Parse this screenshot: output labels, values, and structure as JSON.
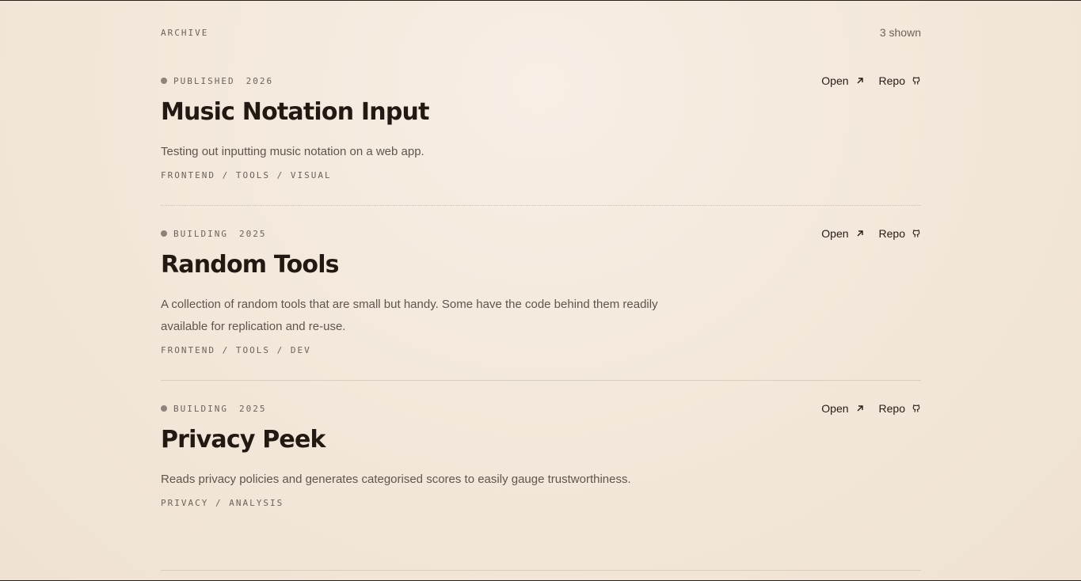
{
  "header": {
    "section_label": "ARCHIVE",
    "count": "3 shown"
  },
  "actions": {
    "open_label": "Open",
    "repo_label": "Repo"
  },
  "projects": [
    {
      "status": "PUBLISHED",
      "year": "2026",
      "title": "Music Notation Input",
      "description": "Testing out inputting music notation on a web app.",
      "tags": "FRONTEND / TOOLS / VISUAL"
    },
    {
      "status": "BUILDING",
      "year": "2025",
      "title": "Random Tools",
      "description": "A collection of random tools that are small but handy. Some have the code behind them readily available for replication and re-use.",
      "tags": "FRONTEND / TOOLS / DEV"
    },
    {
      "status": "BUILDING",
      "year": "2025",
      "title": "Privacy Peek",
      "description": "Reads privacy policies and generates categorised scores to easily gauge trustworthiness.",
      "tags": "PRIVACY / ANALYSIS"
    }
  ],
  "icons": {
    "open": "arrow-up-right-icon",
    "repo": "github-icon",
    "status": "status-dot-icon"
  },
  "colors": {
    "text_primary": "#221913",
    "text_muted": "#6b625a",
    "status_dot": "#8c847c"
  }
}
